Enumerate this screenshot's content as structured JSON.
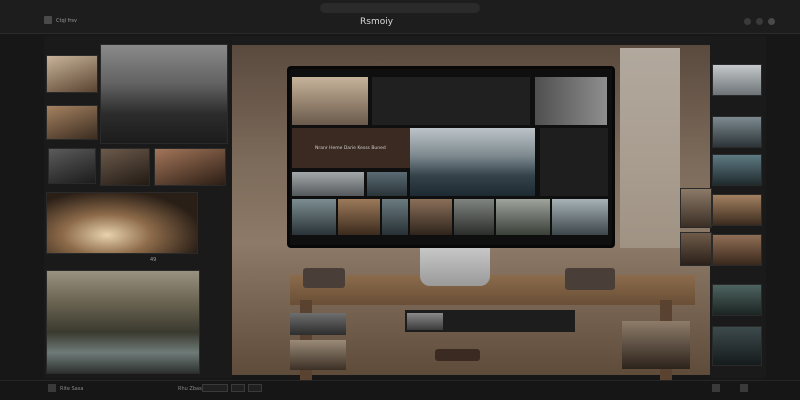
{
  "window": {
    "title": "Rsmoiy",
    "address": "",
    "library_label": "Ctql frsv"
  },
  "left_panel": {
    "header_label": "",
    "badge": "49"
  },
  "monitor": {
    "overlay_text": "Nranr Heme Darie Kesss Buned"
  },
  "bottom_bar": {
    "left_label": "Rite Sasa",
    "center_label": "Rhu Zbas",
    "buttons": [
      "",
      "",
      ""
    ]
  },
  "colors": {
    "background": "#171717",
    "panel": "#1a1a1a",
    "desk": "#8b6b4c"
  },
  "icons": {
    "app_logo": "app-logo-icon",
    "window_controls": [
      "minimize-icon",
      "maximize-icon",
      "close-icon"
    ],
    "left_status": "photo-icon",
    "right_status": "grid-icon"
  }
}
